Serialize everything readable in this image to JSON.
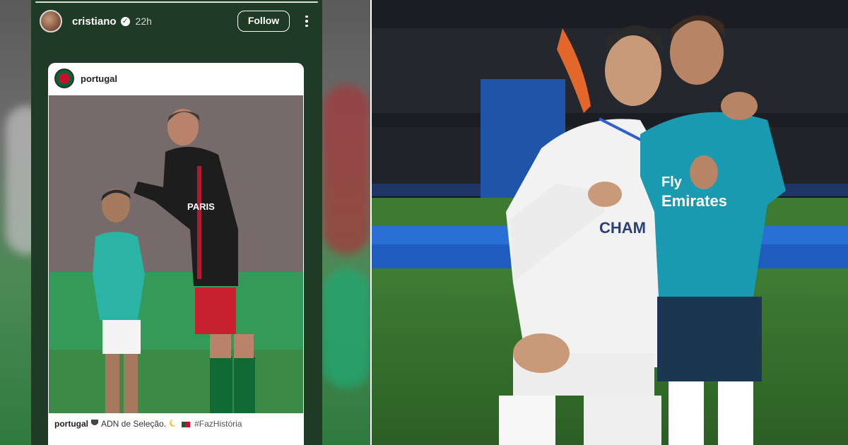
{
  "story": {
    "author": {
      "username": "cristiano",
      "verified": true,
      "timestamp": "22h"
    },
    "follow_label": "Follow",
    "more_icon": "more-vertical-icon",
    "shared_post": {
      "username": "portugal",
      "caption": {
        "username": "portugal",
        "text": "ADN de Seleção.",
        "hashtag": "#FazHistória"
      }
    }
  },
  "colors": {
    "story_background": "#1f3a25",
    "card_background": "#ffffff",
    "portugal_green": "#006633",
    "portugal_red": "#c8102e",
    "real_madrid_teal": "#1a9ab0"
  }
}
